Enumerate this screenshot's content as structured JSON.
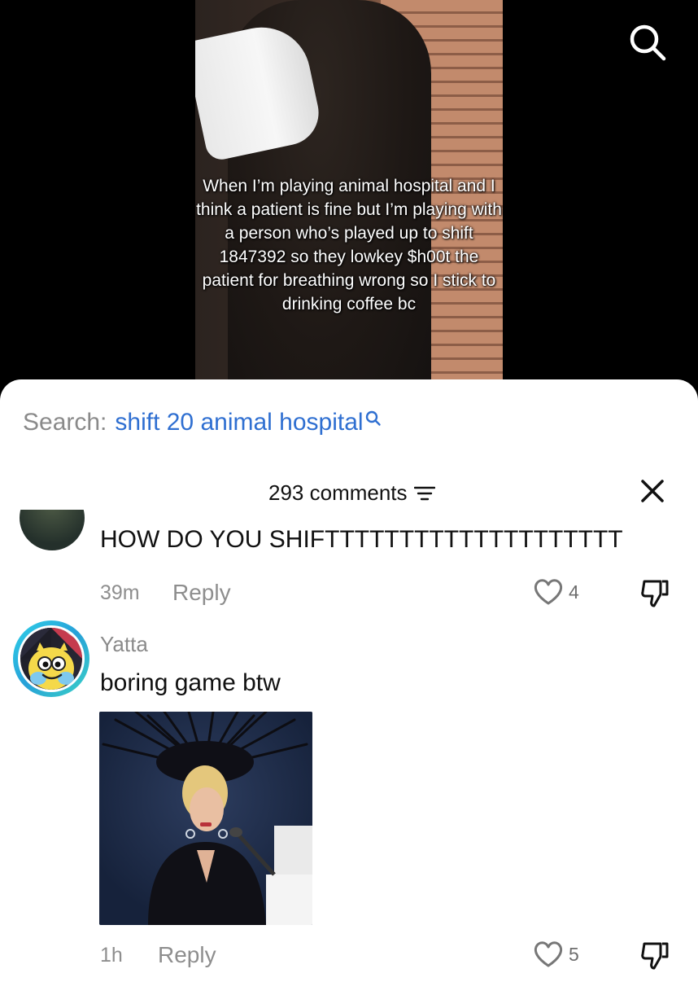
{
  "video": {
    "caption": "When I’m playing animal hospital and I think a patient is fine but I’m playing with a person who’s played up to shift 1847392 so they lowkey $h00t the patient for breathing wrong so I stick to drinking coffee bc"
  },
  "sheet": {
    "search_label": "Search:",
    "search_term": "shift 20 animal hospital",
    "comment_count": "293 comments"
  },
  "comments": [
    {
      "text": "HOW DO YOU SHIFTTTTTTTTTTTTTTTTTTTT",
      "time": "39m",
      "reply_label": "Reply",
      "likes": "4"
    },
    {
      "username": "Yatta",
      "text": "boring game btw",
      "time": "1h",
      "reply_label": "Reply",
      "likes": "5"
    }
  ],
  "colors": {
    "link_blue": "#2f6fd1",
    "avatar_ring": "#2fc6e2"
  },
  "icons": {
    "search": "search-icon",
    "filter": "filter-icon",
    "close": "close-icon",
    "like": "heart-icon",
    "dislike": "thumbs-down-icon"
  }
}
